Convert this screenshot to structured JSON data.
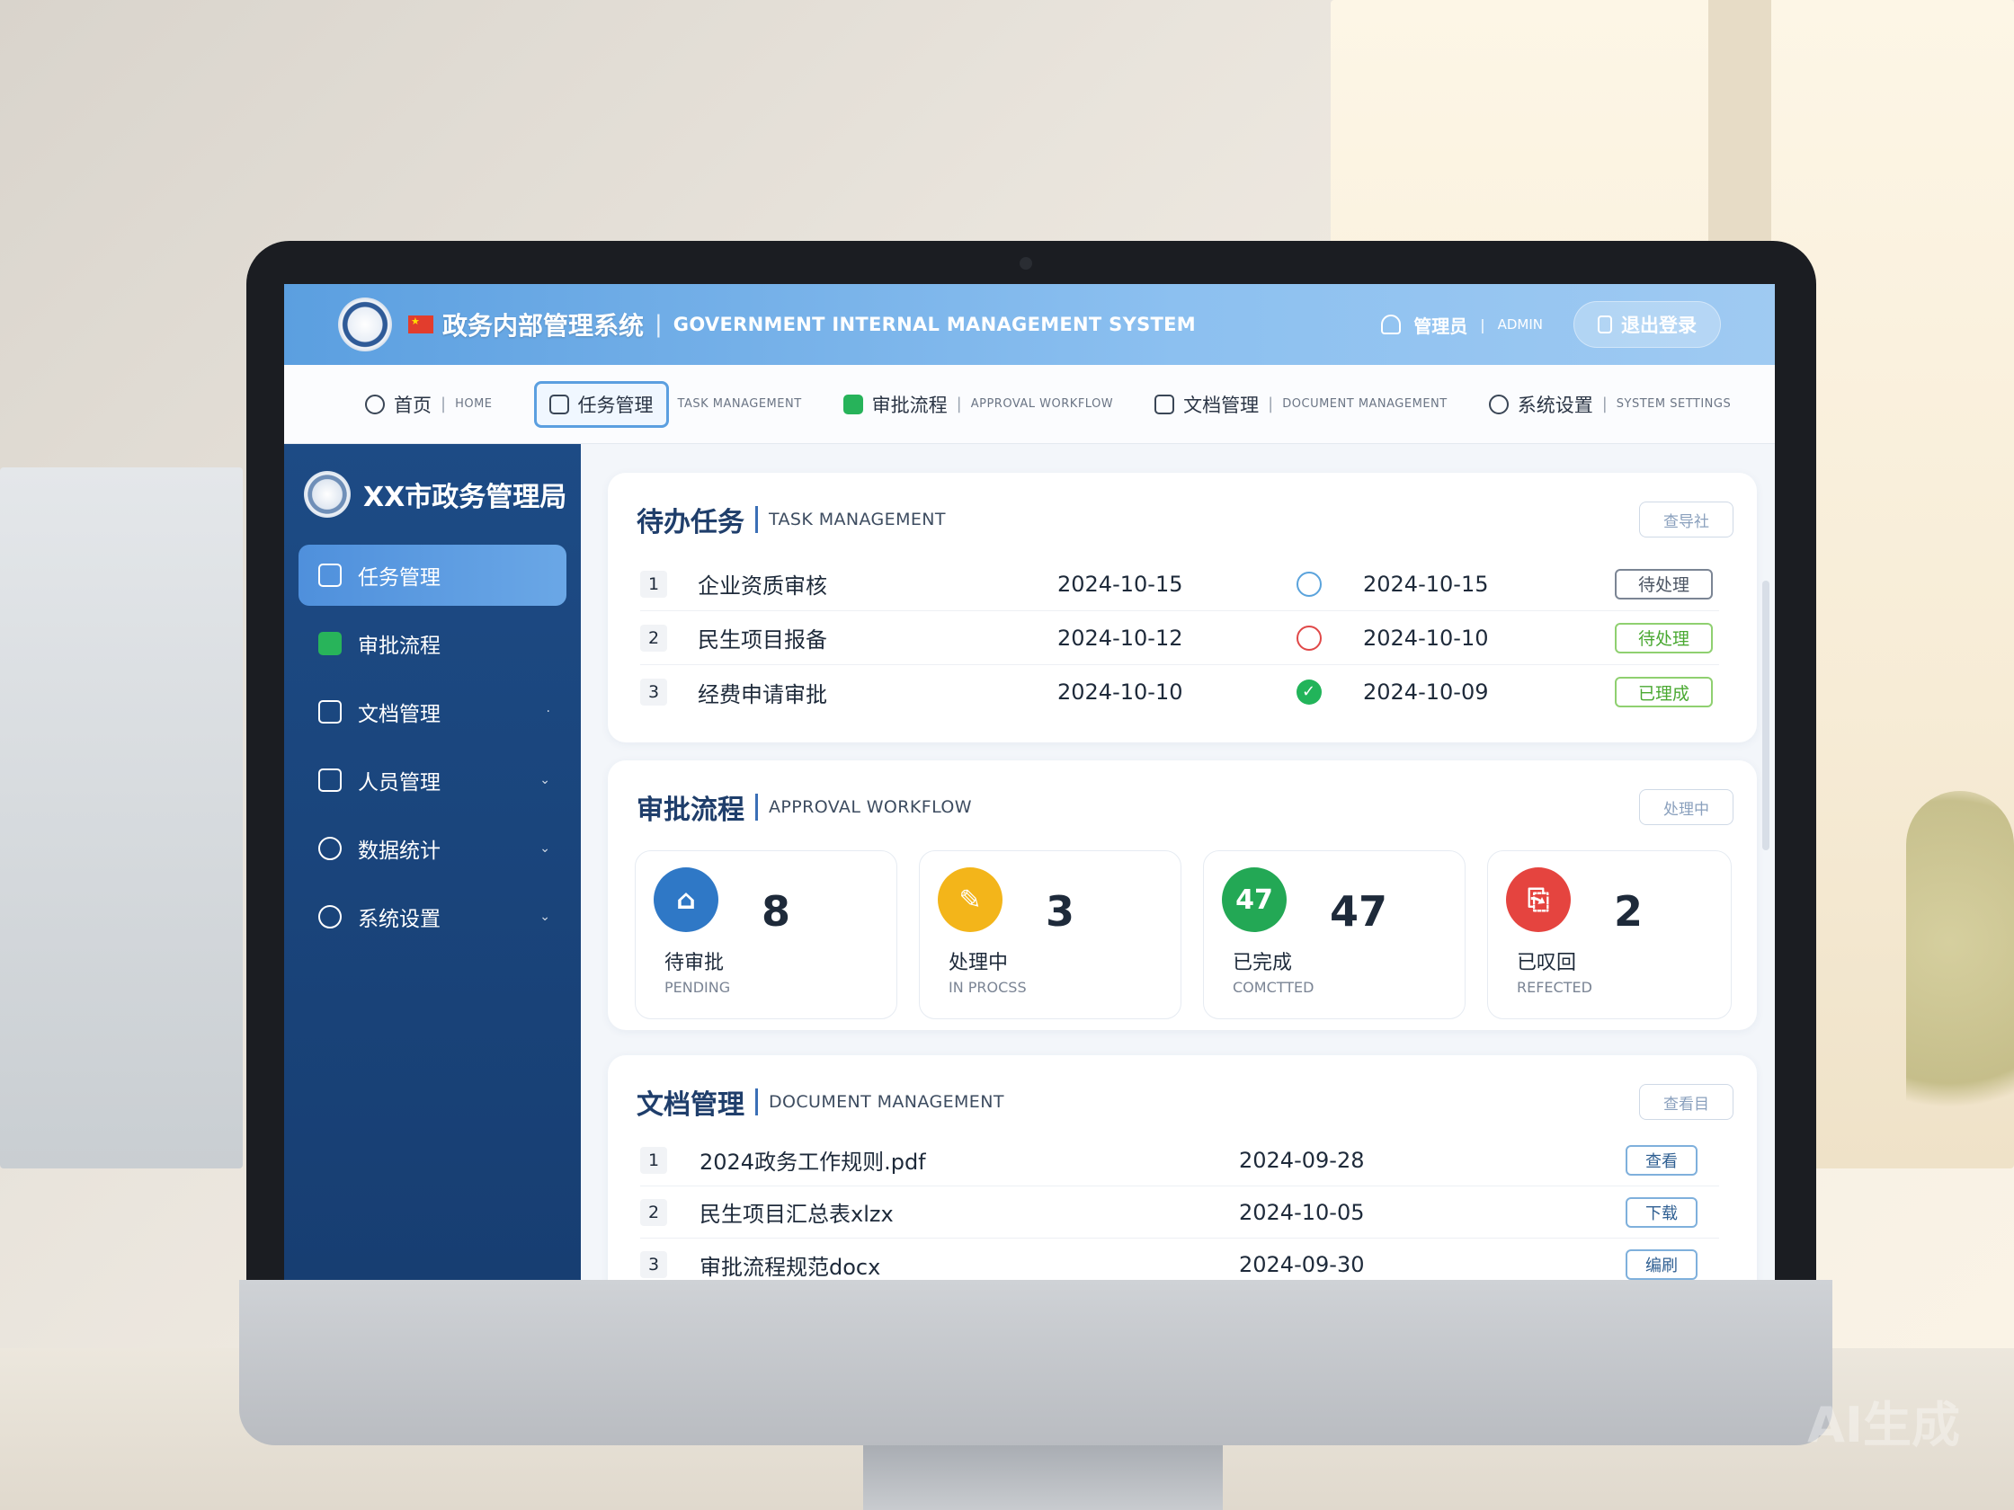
{
  "header": {
    "system_title": "政务内部管理系统",
    "system_subtitle": "GOVERNMENT INTERNAL MANAGEMENT SYSTEM",
    "separator": "|",
    "admin_label": "管理员",
    "admin_en": "ADMIN",
    "logout_label": "退出登录"
  },
  "nav": {
    "items": [
      {
        "label": "首页",
        "en": "HOME",
        "icon": "home-icon"
      },
      {
        "label": "任务管理",
        "en": "TASK MANAGEMENT",
        "icon": "task-icon"
      },
      {
        "label": "审批流程",
        "en": "APPROVAL WORKFLOW",
        "icon": "approval-icon"
      },
      {
        "label": "文档管理",
        "en": "DOCUMENT MANAGEMENT",
        "icon": "document-icon"
      },
      {
        "label": "系统设置",
        "en": "SYSTEM SETTINGS",
        "icon": "settings-icon"
      }
    ],
    "active_index": 1
  },
  "sidebar": {
    "brand": "XX市政务管理局",
    "items": [
      {
        "label": "任务管理",
        "icon": "task-icon",
        "active": true
      },
      {
        "label": "审批流程",
        "icon": "check-icon"
      },
      {
        "label": "文档管理",
        "icon": "document-icon"
      },
      {
        "label": "人员管理",
        "icon": "people-icon"
      },
      {
        "label": "数据统计",
        "icon": "chart-icon"
      },
      {
        "label": "系统设置",
        "icon": "settings-icon"
      }
    ]
  },
  "tasks": {
    "title": "待办任务",
    "subtitle": "TASK MANAGEMENT",
    "button": "查导社",
    "rows": [
      {
        "num": "1",
        "name": "企业资质审核",
        "date1": "2024-10-15",
        "status": "blue-circle",
        "date2": "2024-10-15",
        "tag": "待处理"
      },
      {
        "num": "2",
        "name": "民生项目报备",
        "date1": "2024-10-12",
        "status": "red-circle",
        "date2": "2024-10-10",
        "tag": "待处理"
      },
      {
        "num": "3",
        "name": "经费申请审批",
        "date1": "2024-10-10",
        "status": "green-check",
        "date2": "2024-10-09",
        "tag": "已理成"
      }
    ]
  },
  "approval": {
    "title": "审批流程",
    "subtitle": "APPROVAL WORKFLOW",
    "button": "处理中",
    "stats": [
      {
        "value": "8",
        "label": "待审批",
        "en": "PENDING",
        "color": "#2f78c6",
        "icon_text": ""
      },
      {
        "value": "3",
        "label": "处理中",
        "en": "IN PROCSS",
        "color": "#f3b51a",
        "icon_text": ""
      },
      {
        "value": "47",
        "label": "已完成",
        "en": "COMCTTED",
        "color": "#23a855",
        "icon_text": "47"
      },
      {
        "value": "2",
        "label": "已叹回",
        "en": "REFECTED",
        "color": "#e5443f",
        "icon_text": ""
      }
    ]
  },
  "documents": {
    "title": "文档管理",
    "subtitle": "DOCUMENT MANAGEMENT",
    "button": "查看目",
    "rows": [
      {
        "num": "1",
        "name": "2024政务工作规则.pdf",
        "date": "2024-09-28",
        "action": "查看"
      },
      {
        "num": "2",
        "name": "民生项目汇总表xlzx",
        "date": "2024-10-05",
        "action": "下载"
      },
      {
        "num": "3",
        "name": "审批流程规范docx",
        "date": "2024-09-30",
        "action": "编刷"
      }
    ]
  },
  "watermark": "AI生成"
}
